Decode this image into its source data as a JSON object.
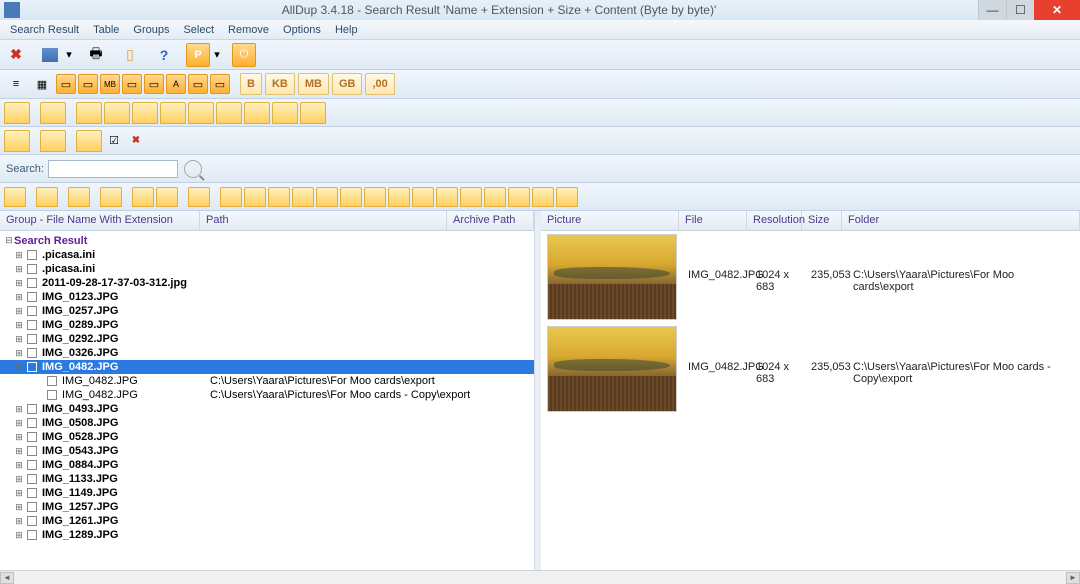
{
  "window": {
    "title": "AllDup 3.4.18 - Search Result 'Name + Extension + Size + Content (Byte by byte)'"
  },
  "menu": [
    "Search Result",
    "Table",
    "Groups",
    "Select",
    "Remove",
    "Options",
    "Help"
  ],
  "size_buttons": [
    "B",
    "KB",
    "MB",
    "GB",
    ",00"
  ],
  "search": {
    "label": "Search:",
    "value": ""
  },
  "left_headers": {
    "group": "Group - File Name With Extension",
    "path": "Path",
    "archive": "Archive Path"
  },
  "tree": {
    "root": "Search Result",
    "groups": [
      {
        "name": ".picasa.ini",
        "bold": true
      },
      {
        "name": ".picasa.ini",
        "bold": true
      },
      {
        "name": "2011-09-28-17-37-03-312.jpg",
        "bold": true
      },
      {
        "name": "IMG_0123.JPG",
        "bold": true
      },
      {
        "name": "IMG_0257.JPG",
        "bold": true
      },
      {
        "name": "IMG_0289.JPG",
        "bold": true
      },
      {
        "name": "IMG_0292.JPG",
        "bold": true
      },
      {
        "name": "IMG_0326.JPG",
        "bold": true
      },
      {
        "name": "IMG_0482.JPG",
        "bold": true,
        "selected": true,
        "expanded": true,
        "children": [
          {
            "name": "IMG_0482.JPG",
            "path": "C:\\Users\\Yaara\\Pictures\\For Moo cards\\export"
          },
          {
            "name": "IMG_0482.JPG",
            "path": "C:\\Users\\Yaara\\Pictures\\For Moo cards - Copy\\export"
          }
        ]
      },
      {
        "name": "IMG_0493.JPG",
        "bold": true
      },
      {
        "name": "IMG_0508.JPG",
        "bold": true
      },
      {
        "name": "IMG_0528.JPG",
        "bold": true
      },
      {
        "name": "IMG_0543.JPG",
        "bold": true
      },
      {
        "name": "IMG_0884.JPG",
        "bold": true
      },
      {
        "name": "IMG_1133.JPG",
        "bold": true
      },
      {
        "name": "IMG_1149.JPG",
        "bold": true
      },
      {
        "name": "IMG_1257.JPG",
        "bold": true
      },
      {
        "name": "IMG_1261.JPG",
        "bold": true
      },
      {
        "name": "IMG_1289.JPG",
        "bold": true
      }
    ]
  },
  "right_headers": {
    "picture": "Picture",
    "file": "File",
    "resolution": "Resolution",
    "size": "Size",
    "folder": "Folder"
  },
  "preview_rows": [
    {
      "file": "IMG_0482.JPG",
      "resolution": "1024 x 683",
      "size": "235,053",
      "folder": "C:\\Users\\Yaara\\Pictures\\For Moo cards\\export"
    },
    {
      "file": "IMG_0482.JPG",
      "resolution": "1024 x 683",
      "size": "235,053",
      "folder": "C:\\Users\\Yaara\\Pictures\\For Moo cards - Copy\\export"
    }
  ]
}
